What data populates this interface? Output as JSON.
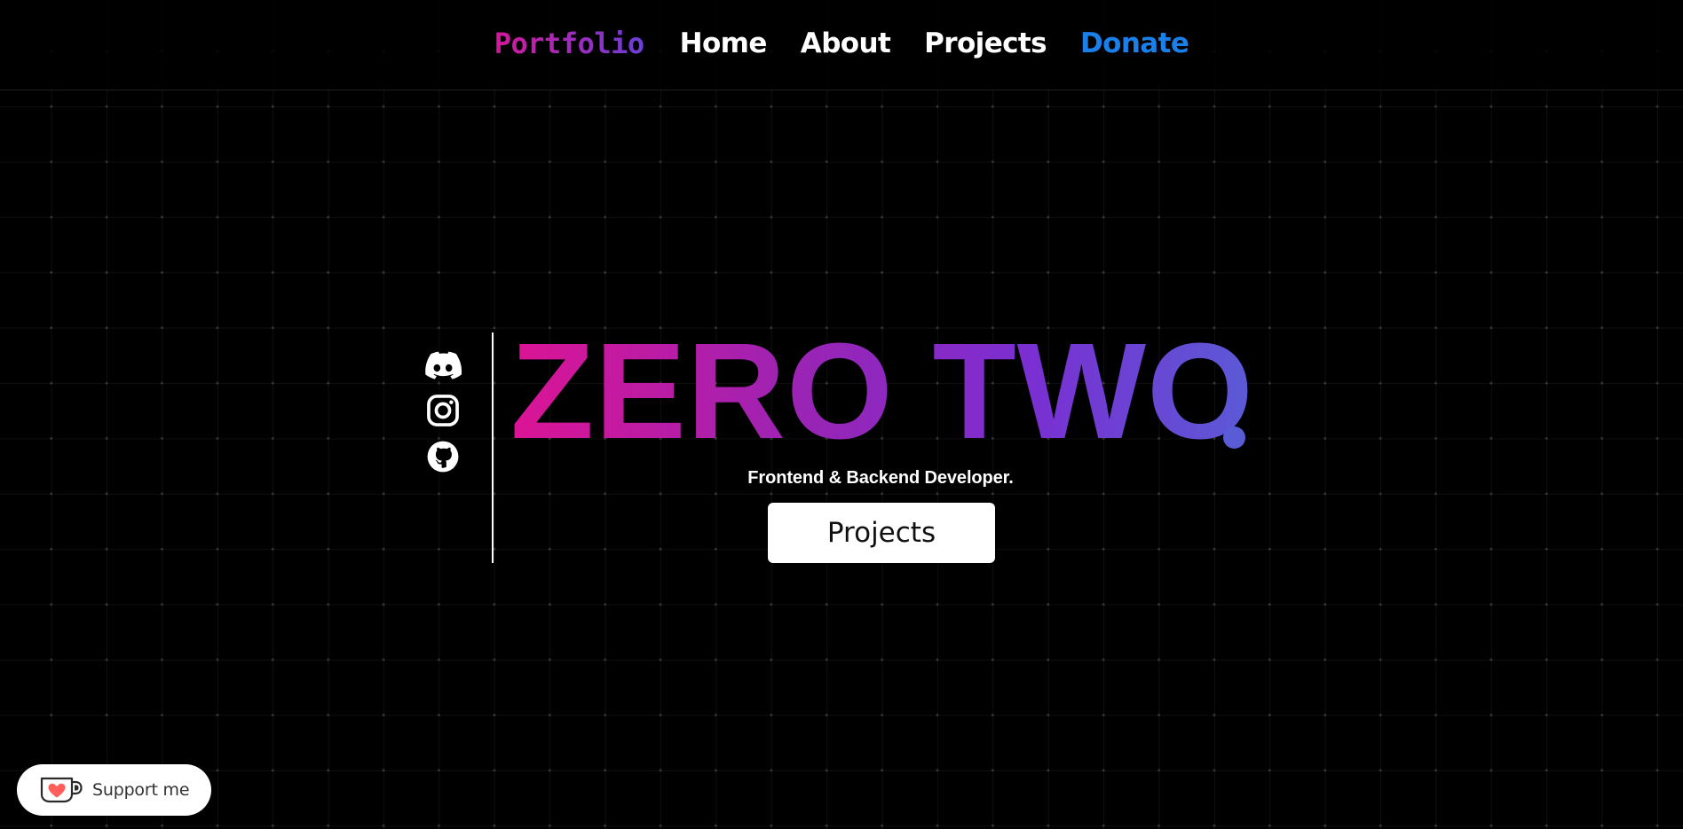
{
  "nav": {
    "brand": "Portfolio",
    "links": [
      {
        "label": "Home"
      },
      {
        "label": "About"
      },
      {
        "label": "Projects"
      },
      {
        "label": "Donate"
      }
    ]
  },
  "socials": [
    {
      "icon": "discord-icon"
    },
    {
      "icon": "instagram-icon"
    },
    {
      "icon": "github-icon"
    }
  ],
  "hero": {
    "title": "ZERO TWO",
    "subtitle": "Frontend & Backend Developer.",
    "cta_label": "Projects"
  },
  "support": {
    "label": "Support me",
    "icon": "coffee-cup-heart-icon"
  },
  "colors": {
    "background": "#000000",
    "brand_gradient_start": "#d6179c",
    "brand_gradient_end": "#6a3fd8",
    "title_gradient_start": "#dc1495",
    "title_gradient_end": "#5a5bd6",
    "donate_link": "#1a7fe8",
    "accent_dot": "#5a5cd6",
    "support_heart": "#ff5e5b"
  }
}
